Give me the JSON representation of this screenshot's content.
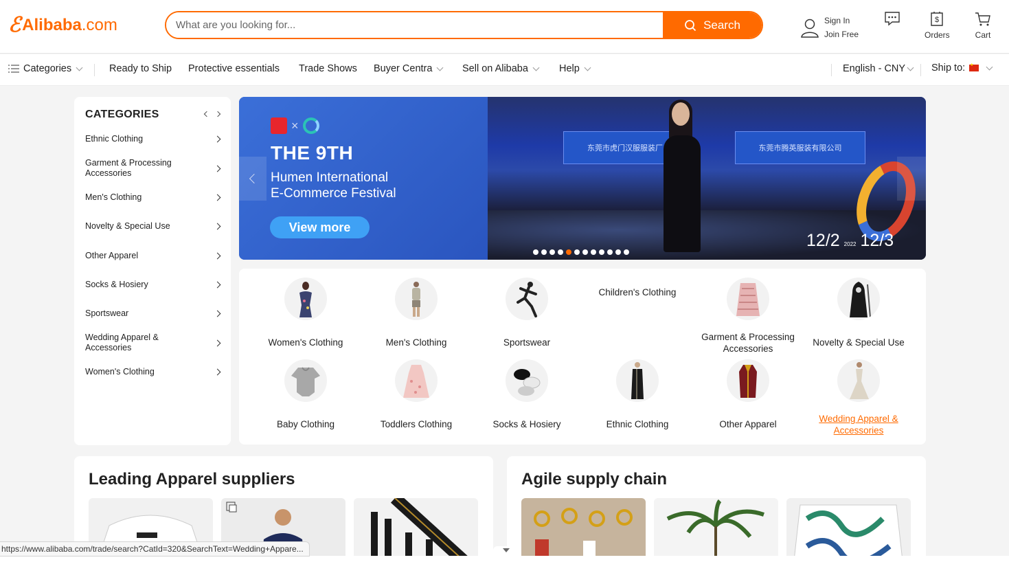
{
  "header": {
    "logo_text": "Alibaba",
    "logo_suffix": ".com",
    "search_placeholder": "What are you looking for...",
    "search_button": "Search",
    "sign_in": "Sign In",
    "join_free": "Join Free",
    "orders": "Orders",
    "cart": "Cart",
    "icons": [
      "user-icon",
      "messages-icon",
      "orders-icon",
      "cart-icon",
      "search-icon"
    ]
  },
  "nav": {
    "categories": "Categories",
    "items": [
      "Ready to Ship",
      "Protective essentials",
      "Trade Shows",
      "Buyer Centra",
      "Sell on Alibaba",
      "Help"
    ],
    "language": "English - CNY",
    "ship_to": "Ship to:"
  },
  "sidebar": {
    "title": "CATEGORIES",
    "items": [
      "Ethnic Clothing",
      "Garment & Processing Accessories",
      "Men's Clothing",
      "Novelty & Special Use",
      "Other Apparel",
      "Socks & Hosiery",
      "Sportswear",
      "Wedding Apparel & Accessories",
      "Women's Clothing"
    ]
  },
  "banner": {
    "title": "THE 9TH",
    "subtitle_line1": "Humen International",
    "subtitle_line2": "E-Commerce Festival",
    "button": "View more",
    "date_start": "12/2",
    "year": "2022",
    "date_end": "12/3",
    "sign_left": "东莞市虎门汉服服装厂",
    "sign_right": "东莞市腾英服装有限公司",
    "dots_total": 12,
    "dots_active_index": 4,
    "accent": "#ff6a00"
  },
  "category_grid": [
    {
      "label": "Women's Clothing"
    },
    {
      "label": "Men's Clothing"
    },
    {
      "label": "Sportswear"
    },
    {
      "label": "Children's Clothing"
    },
    {
      "label": "Garment & Processing Accessories"
    },
    {
      "label": "Novelty & Special Use"
    },
    {
      "label": "Baby Clothing"
    },
    {
      "label": "Toddlers Clothing"
    },
    {
      "label": "Socks & Hosiery"
    },
    {
      "label": "Ethnic Clothing"
    },
    {
      "label": "Other Apparel"
    },
    {
      "label": "Wedding Apparel & Accessories"
    }
  ],
  "sections": {
    "left_title": "Leading Apparel suppliers",
    "right_title": "Agile supply chain"
  },
  "status_url": "https://www.alibaba.com/trade/search?CatId=320&SearchText=Wedding+Appare..."
}
